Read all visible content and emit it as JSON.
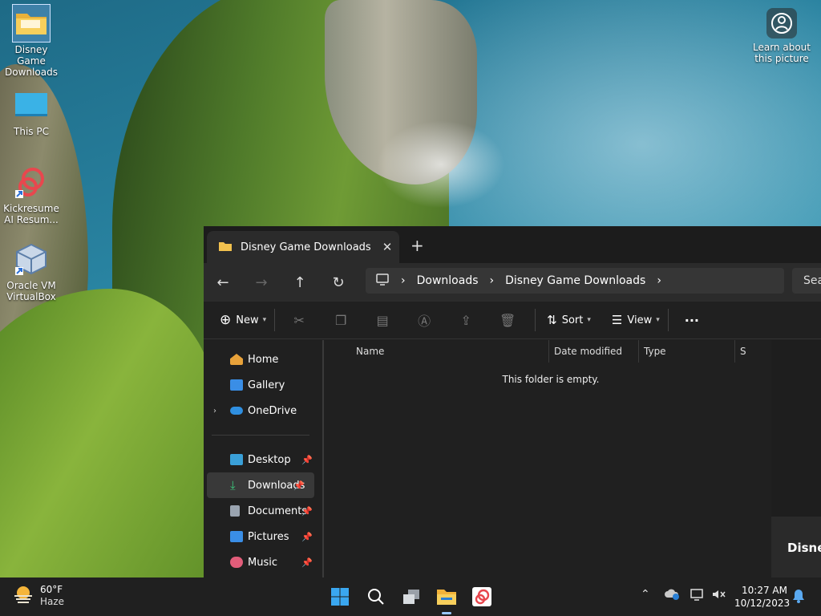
{
  "desktop": {
    "icons": [
      {
        "label": "Disney Game Downloads"
      },
      {
        "label": "This PC"
      },
      {
        "label": "Kickresume AI Resum..."
      },
      {
        "label": "Oracle VM VirtualBox"
      }
    ],
    "learn_label": "Learn about this picture"
  },
  "explorer": {
    "tab_title": "Disney Game Downloads",
    "tab_close": "✕",
    "new_tab": "+",
    "breadcrumb": [
      "Downloads",
      "Disney Game Downloads"
    ],
    "search_placeholder": "Sea",
    "toolbar": {
      "new": "New",
      "sort": "Sort",
      "view": "View",
      "more": "···"
    },
    "nav": {
      "home": "Home",
      "gallery": "Gallery",
      "onedrive": "OneDrive",
      "desktop": "Desktop",
      "downloads": "Downloads",
      "documents": "Documents",
      "pictures": "Pictures",
      "music": "Music"
    },
    "columns": {
      "name": "Name",
      "date": "Date modified",
      "type": "Type",
      "size": "S"
    },
    "empty_message": "This folder is empty.",
    "preview_title": "Disney"
  },
  "taskbar": {
    "temp": "60°F",
    "condition": "Haze",
    "time": "10:27 AM",
    "date": "10/12/2023"
  }
}
